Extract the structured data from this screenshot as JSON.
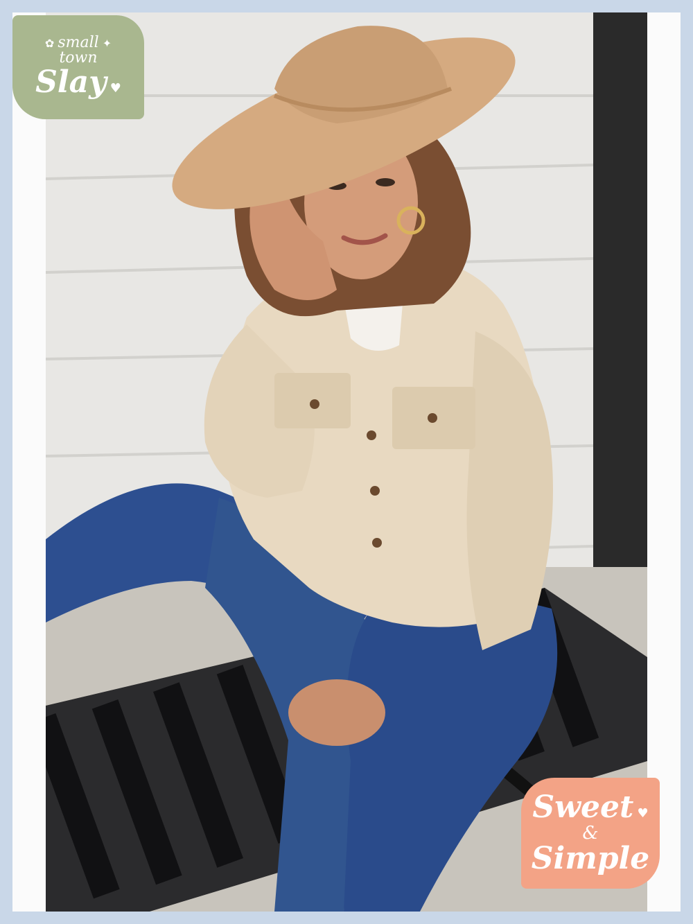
{
  "badges": {
    "top": {
      "line1": "small",
      "line2": "town",
      "line3": "Slay",
      "color": "#a9b78f"
    },
    "bottom": {
      "line1": "Sweet",
      "line2": "&",
      "line3": "Simple",
      "color": "#f3a386"
    }
  },
  "colors": {
    "background": "#c9d7e8",
    "wall": "#e7e6e3",
    "hat": "#d4a97e",
    "jacket": "#e6d7bf",
    "jeans": "#2e4f8e",
    "bench": "#1c1c1e"
  },
  "icons": [
    "sparkle-icon",
    "flower-icon",
    "heart-icon"
  ]
}
